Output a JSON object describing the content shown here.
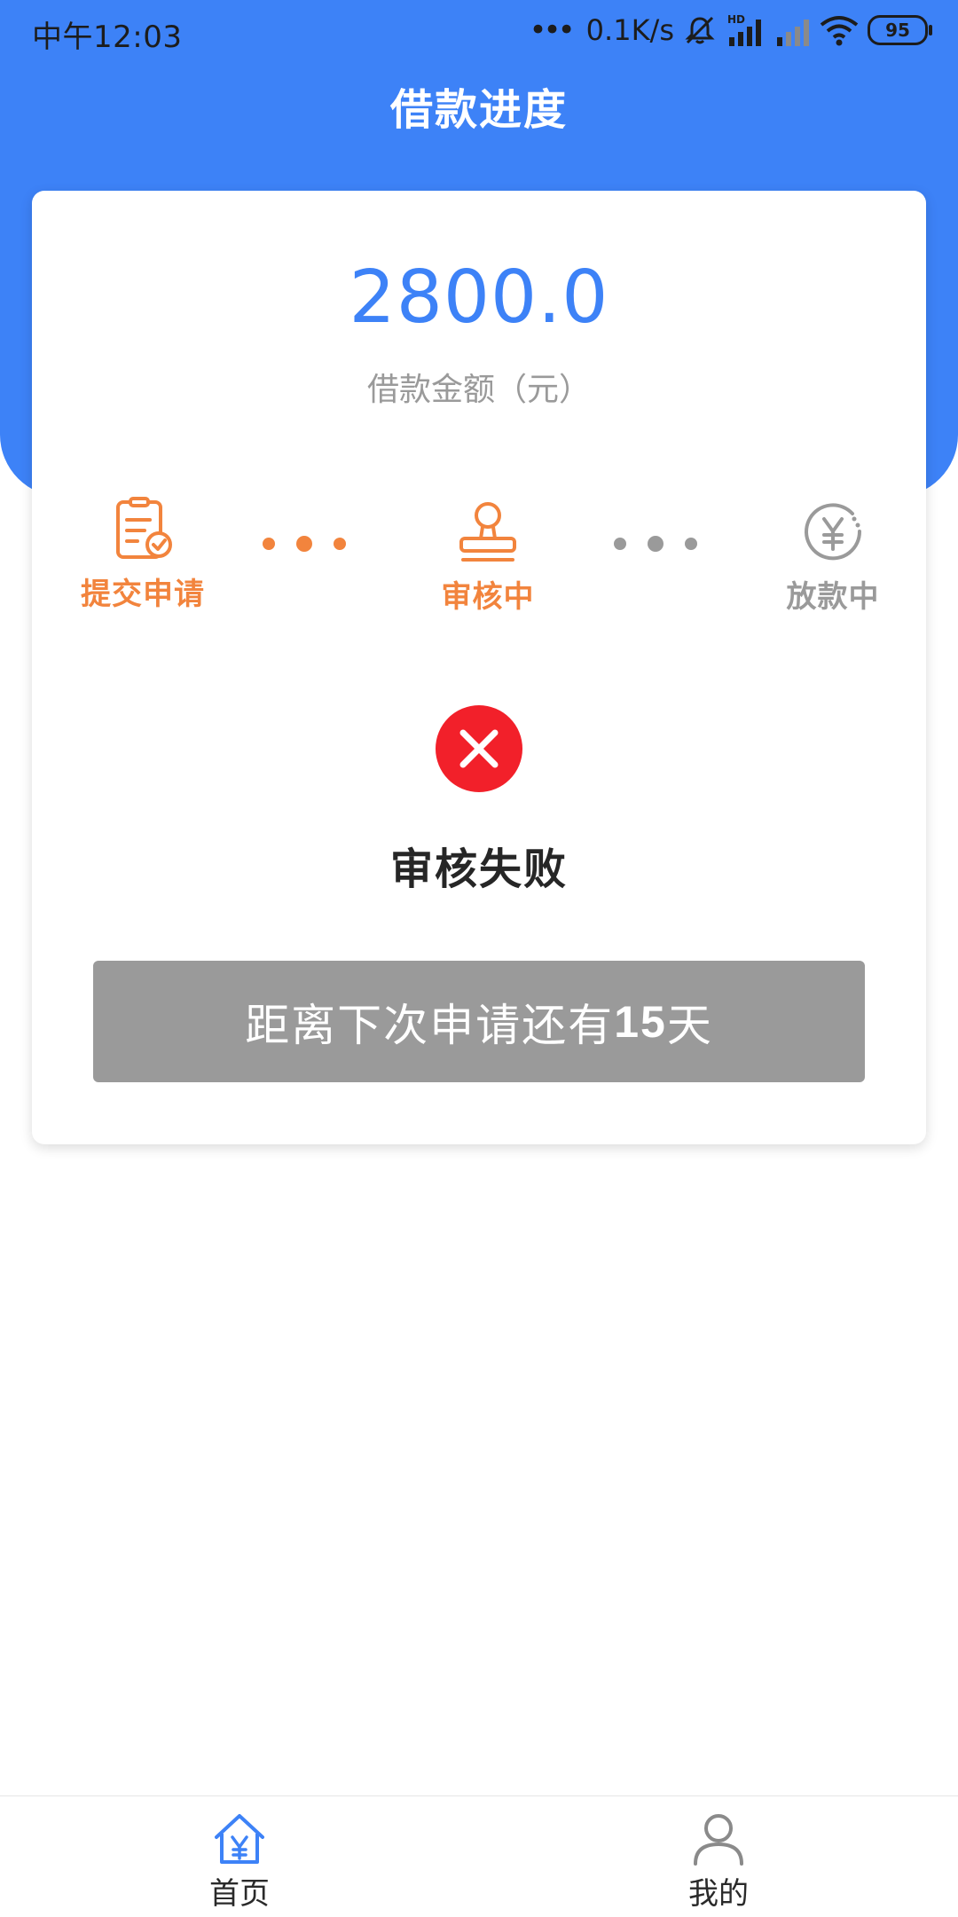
{
  "status_bar": {
    "time": "中午12:03",
    "network_dots": "•••",
    "speed": "0.1K/s",
    "hd_label": "HD",
    "battery": "95"
  },
  "header": {
    "title": "借款进度"
  },
  "loan": {
    "amount": "2800.0",
    "amount_label": "借款金额（元）"
  },
  "steps": [
    {
      "label": "提交申请",
      "icon": "document-check-icon",
      "state": "done"
    },
    {
      "label": "审核中",
      "icon": "stamp-icon",
      "state": "active"
    },
    {
      "label": "放款中",
      "icon": "yuan-clock-icon",
      "state": "pending"
    }
  ],
  "result": {
    "icon": "close-circle-icon",
    "status": "审核失败"
  },
  "next_apply": {
    "prefix": "距离下次申请还有",
    "days": "15",
    "suffix": "天"
  },
  "bottom_nav": [
    {
      "label": "首页",
      "icon": "home-yuan-icon",
      "active": true
    },
    {
      "label": "我的",
      "icon": "user-icon",
      "active": false
    }
  ],
  "colors": {
    "primary": "#3d82f7",
    "orange": "#f2843d",
    "grey": "#9a9a9a",
    "error": "#f2202a"
  }
}
